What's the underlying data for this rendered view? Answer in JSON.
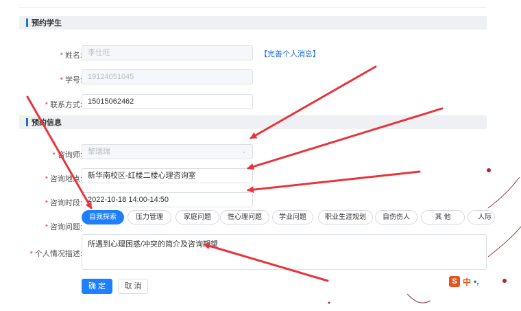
{
  "sections": {
    "student": "预约学生",
    "booking": "预约信息"
  },
  "student": {
    "name_label": "姓名:",
    "name_value": "李仕旺",
    "complete_link": "【完善个人消息】",
    "id_label": "学号:",
    "id_value": "19124051045",
    "contact_label": "联系方式:",
    "contact_value": "15015062462"
  },
  "booking": {
    "counselor_label": "咨询师:",
    "counselor_value": "黎瑞瑞",
    "location_label": "咨询地点:",
    "location_value": "新华南校区-红楼二楼心理咨询室",
    "time_label": "咨询时段:",
    "time_value": "2022-10-18 14:00-14:50",
    "issue_label": "咨询问题:",
    "issues": [
      "自我探索",
      "压力管理",
      "家庭问题",
      "性心理问题",
      "学业问题",
      "职业生涯规划",
      "自伤伤人",
      "其 他",
      "人际"
    ],
    "selected_issue": "自我探索",
    "desc_label": "个人情况描述:",
    "desc_value": "所遇到心理困惑/冲突的简介及咨询期望"
  },
  "required_mark": "*",
  "actions": {
    "confirm": "确 定",
    "cancel": "取 消"
  },
  "ime": {
    "logo": "S",
    "mode": "中",
    "punct": "•,"
  },
  "colors": {
    "primary": "#1e80ff",
    "arrow": "#e8333a",
    "required": "#e33333"
  },
  "icons": {
    "select": "chevron-down-icon"
  }
}
